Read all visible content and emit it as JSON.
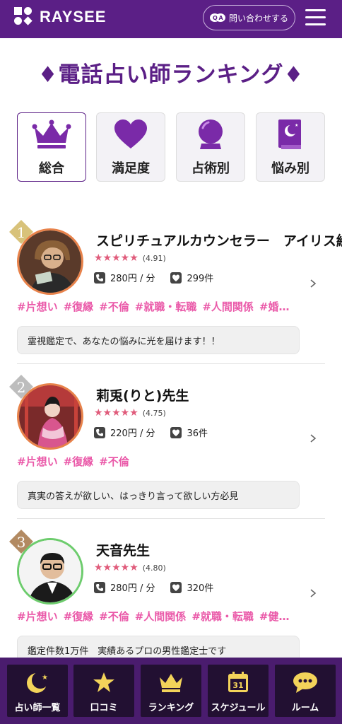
{
  "header": {
    "logo_text": "RAYSEE",
    "contact_label": "問い合わせする"
  },
  "page_title": "♦電話占い師ランキング♦",
  "tabs": [
    {
      "label": "総合",
      "icon": "crown-icon",
      "active": true
    },
    {
      "label": "満足度",
      "icon": "heart-icon",
      "active": false
    },
    {
      "label": "占術別",
      "icon": "crystal-ball-icon",
      "active": false
    },
    {
      "label": "悩み別",
      "icon": "book-icon",
      "active": false
    }
  ],
  "fortune_tellers": [
    {
      "rank": "1",
      "name": "スピリチュアルカウンセラー　アイリス絵",
      "stars": "★★★★★",
      "rating": "(4.91)",
      "price": "280円 / 分",
      "likes": "299件",
      "tags": [
        "#片想い",
        "#復縁",
        "#不倫",
        "#就職・転職",
        "#人間関係",
        "#婚…"
      ],
      "message": "霊視鑑定で、あなたの悩みに光を届けます！！"
    },
    {
      "rank": "2",
      "name": "莉兎(りと)先生",
      "stars": "★★★★★",
      "rating": "(4.75)",
      "price": "220円 / 分",
      "likes": "36件",
      "tags": [
        "#片想い",
        "#復縁",
        "#不倫"
      ],
      "message": "真実の答えが欲しい、はっきり言って欲しい方必見"
    },
    {
      "rank": "3",
      "name": "天音先生",
      "stars": "★★★★★",
      "rating": "(4.80)",
      "price": "280円 / 分",
      "likes": "320件",
      "tags": [
        "#片想い",
        "#復縁",
        "#不倫",
        "#人間関係",
        "#就職・転職",
        "#健…"
      ],
      "message": "鑑定件数1万件　実績あるプロの男性鑑定士です"
    }
  ],
  "bottom_nav": [
    {
      "label": "占い師一覧",
      "icon": "moon-star-icon"
    },
    {
      "label": "口コミ",
      "icon": "star-icon"
    },
    {
      "label": "ランキング",
      "icon": "crown-icon"
    },
    {
      "label": "スケジュール",
      "icon": "calendar-icon",
      "calendar_day": "31"
    },
    {
      "label": "ルーム",
      "icon": "chat-bubble-icon"
    }
  ],
  "colors": {
    "brand_purple": "#5b1f86",
    "tag_pink": "#ea5aa9",
    "star_pink": "#e05b7b",
    "nav_bg": "#4a1c6e"
  }
}
